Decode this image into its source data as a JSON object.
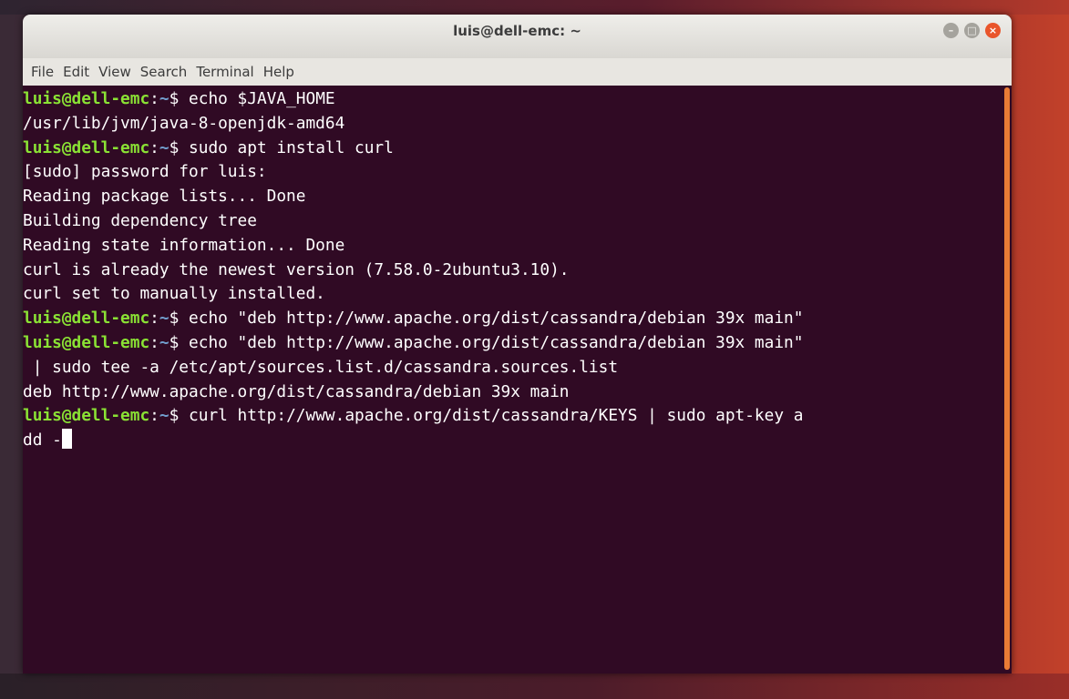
{
  "window": {
    "title": "luis@dell-emc: ~",
    "controls": {
      "minimize": "–",
      "maximize": "□",
      "close": "×"
    }
  },
  "menu": {
    "items": [
      "File",
      "Edit",
      "View",
      "Search",
      "Terminal",
      "Help"
    ]
  },
  "terminal": {
    "prompt_user": "luis@dell-emc",
    "prompt_sep": ":",
    "prompt_path": "~",
    "prompt_symbol": "$ ",
    "lines": [
      {
        "type": "prompt",
        "text": "echo $JAVA_HOME"
      },
      {
        "type": "output",
        "text": "/usr/lib/jvm/java-8-openjdk-amd64"
      },
      {
        "type": "prompt",
        "text": "sudo apt install curl"
      },
      {
        "type": "output",
        "text": "[sudo] password for luis:"
      },
      {
        "type": "output",
        "text": "Reading package lists... Done"
      },
      {
        "type": "output",
        "text": "Building dependency tree"
      },
      {
        "type": "output",
        "text": "Reading state information... Done"
      },
      {
        "type": "output",
        "text": "curl is already the newest version (7.58.0-2ubuntu3.10)."
      },
      {
        "type": "output",
        "text": "curl set to manually installed."
      },
      {
        "type": "prompt",
        "text": "echo \"deb http://www.apache.org/dist/cassandra/debian 39x main\""
      },
      {
        "type": "prompt",
        "text": "echo \"deb http://www.apache.org/dist/cassandra/debian 39x main\""
      },
      {
        "type": "output",
        "text": " | sudo tee -a /etc/apt/sources.list.d/cassandra.sources.list"
      },
      {
        "type": "output",
        "text": "deb http://www.apache.org/dist/cassandra/debian 39x main"
      },
      {
        "type": "prompt",
        "text": "curl http://www.apache.org/dist/cassandra/KEYS | sudo apt-key a"
      },
      {
        "type": "input",
        "text": "dd -"
      }
    ]
  },
  "colors": {
    "terminal_bg": "#300a24",
    "prompt_user": "#8ae234",
    "prompt_path": "#729fcf",
    "text": "#ffffff",
    "close_button": "#e9552b"
  }
}
